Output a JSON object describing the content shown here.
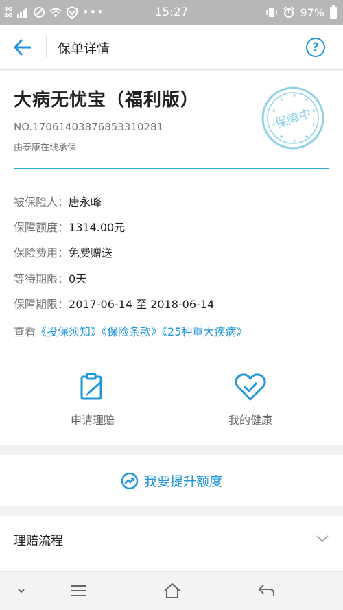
{
  "status_bar": {
    "network": "4G",
    "network2": "2G",
    "time": "15:27",
    "battery": "97%"
  },
  "nav": {
    "title": "保单详情",
    "help": "?"
  },
  "policy": {
    "name": "大病无忧宝（福利版）",
    "number": "NO.17061403876853310281",
    "underwriter": "由泰康在线承保",
    "stamp_text": "保障中"
  },
  "details": [
    {
      "label": "被保险人：",
      "value": "唐永峰"
    },
    {
      "label": "保障额度：",
      "value": "1314.00元"
    },
    {
      "label": "保险费用：",
      "value": "免费赠送"
    },
    {
      "label": "等待期限：",
      "value": "0天"
    },
    {
      "label": "保障期限：",
      "value": "2017-06-14 至 2018-06-14"
    }
  ],
  "links": {
    "prefix": "查看",
    "items": [
      "《投保须知》",
      "《保险条款》",
      "《25种重大疾病》"
    ]
  },
  "actions": {
    "claim": "申请理赔",
    "health": "我的健康"
  },
  "upgrade": {
    "label": "我要提升额度"
  },
  "process": {
    "label": "理赔流程"
  },
  "colors": {
    "accent": "#2196d9",
    "stamp": "#8fd1e6",
    "divider": "#2aa7d8"
  }
}
